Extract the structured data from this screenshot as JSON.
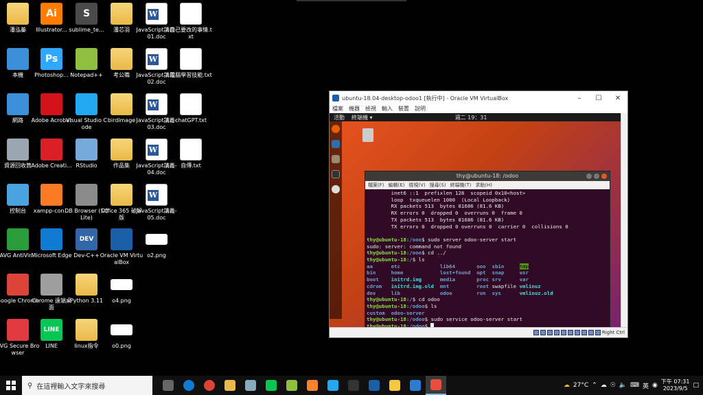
{
  "desktop_icons": [
    {
      "label": "潘泓蓁",
      "icon": "user-folder-icon",
      "color": "#e3b341"
    },
    {
      "label": "本機",
      "icon": "computer-icon",
      "color": "#3b8fd8"
    },
    {
      "label": "網路",
      "icon": "network-icon",
      "color": "#3b8fd8"
    },
    {
      "label": "資源回收筒",
      "icon": "recycle-bin-icon",
      "color": "#9aa6b2"
    },
    {
      "label": "控制台",
      "icon": "control-panel-icon",
      "color": "#4aa3df"
    },
    {
      "label": "AVG AntiVir...",
      "icon": "avg-icon",
      "color": "#2a9d3a"
    },
    {
      "label": "Google Chrome",
      "icon": "chrome-icon",
      "color": "#db4437"
    },
    {
      "label": "AVG Secure Browser",
      "icon": "avg-browser-icon",
      "color": "#e03a3e"
    },
    {
      "label": "Illustrator...",
      "icon": "illustrator-icon",
      "color": "#ff7c00",
      "text": "Ai"
    },
    {
      "label": "Photoshop...",
      "icon": "photoshop-icon",
      "color": "#31a8ff",
      "text": "Ps"
    },
    {
      "label": "Adobe Acrobat",
      "icon": "acrobat-icon",
      "color": "#d4121b"
    },
    {
      "label": "Adobe Creati...",
      "icon": "creative-cloud-icon",
      "color": "#da1f26"
    },
    {
      "label": "xampp-con...",
      "icon": "xampp-icon",
      "color": "#fb7a24"
    },
    {
      "label": "Microsoft Edge",
      "icon": "edge-icon",
      "color": "#0f7bd3"
    },
    {
      "label": "Chrome 遠端桌面",
      "icon": "chrome-remote-icon",
      "color": "#9e9e9e"
    },
    {
      "label": "LINE",
      "icon": "line-icon",
      "color": "#06c755",
      "text": "LINE"
    },
    {
      "label": "sublime_te...",
      "icon": "sublime-icon",
      "color": "#4a4a4a",
      "text": "S"
    },
    {
      "label": "Notepad++",
      "icon": "notepadpp-icon",
      "color": "#90c040"
    },
    {
      "label": "Visual Studio Code",
      "icon": "vscode-icon",
      "color": "#23a9f2"
    },
    {
      "label": "RStudio",
      "icon": "rstudio-icon",
      "color": "#75aadb"
    },
    {
      "label": "DB Browser (SQLite)",
      "icon": "database-icon",
      "color": "#8a8a8a"
    },
    {
      "label": "Dev-C++",
      "icon": "devcpp-icon",
      "color": "#3166a8",
      "text": "DEV"
    },
    {
      "label": "Python 3.11",
      "icon": "python-folder-icon",
      "color": "#e9b949"
    },
    {
      "label": "linux指令",
      "icon": "folder-icon",
      "color": "#e9b949"
    },
    {
      "label": "潘芯羽",
      "icon": "folder-icon",
      "color": "#e9b949"
    },
    {
      "label": "考公職",
      "icon": "folder-icon",
      "color": "#e9b949"
    },
    {
      "label": "birdimage",
      "icon": "folder-icon",
      "color": "#e9b949"
    },
    {
      "label": "作品集",
      "icon": "folder-icon",
      "color": "#e9b949"
    },
    {
      "label": "Office 365 破解版",
      "icon": "folder-icon",
      "color": "#e9b949"
    },
    {
      "label": "Oracle VM VirtualBox",
      "icon": "virtualbox-icon",
      "color": "#1b5fa8"
    },
    {
      "label": "o4.png",
      "icon": "image-icon",
      "color": "#ffffff"
    },
    {
      "label": "o0.png",
      "icon": "image-icon",
      "color": "#ffffff"
    },
    {
      "label": "JavaScript講義-01.doc",
      "icon": "word-doc-icon",
      "color": "#2b579a"
    },
    {
      "label": "JavaScript講義-02.doc",
      "icon": "word-doc-icon",
      "color": "#2b579a"
    },
    {
      "label": "JavaScript講義-03.doc",
      "icon": "word-doc-icon",
      "color": "#2b579a"
    },
    {
      "label": "JavaScript講義-04.doc",
      "icon": "word-doc-icon",
      "color": "#2b579a"
    },
    {
      "label": "JavaScript講義-05.doc",
      "icon": "word-doc-icon",
      "color": "#2b579a"
    },
    {
      "label": "o2.png",
      "icon": "image-icon",
      "color": "#ffffff"
    },
    {
      "label": "自己要改的事情.txt",
      "icon": "text-file-icon",
      "color": "#ffffff"
    },
    {
      "label": "電腦學習技能.txt",
      "icon": "text-file-icon",
      "color": "#ffffff"
    },
    {
      "label": "chatGPT.txt",
      "icon": "text-file-icon",
      "color": "#ffffff"
    },
    {
      "label": "自傳.txt",
      "icon": "text-file-icon",
      "color": "#ffffff"
    }
  ],
  "vbox": {
    "title": "ubuntu-18.04-desktop-odoo1 [執行中] - Oracle VM VirtualBox",
    "menu": [
      "檔案",
      "機器",
      "檢視",
      "輸入",
      "裝置",
      "說明"
    ],
    "host_key": "Right Ctrl",
    "guest": {
      "activities": "活動",
      "app_menu": "終端機 ▾",
      "clock": "週二 19：31"
    }
  },
  "terminal": {
    "title": "thy@ubuntu-18: /odoo",
    "menu": [
      "檔案(F)",
      "編輯(E)",
      "檢視(V)",
      "搜尋(S)",
      "終端機(T)",
      "求助(H)"
    ],
    "lines_plain": [
      "        inet6 ::1  prefixlen 128  scopeid 0x10<host>",
      "        loop  txqueuelen 1000  (Local Loopback)",
      "        RX packets 513  bytes 81686 (81.6 KB)",
      "        RX errors 0  dropped 0  overruns 0  frame 0",
      "        TX packets 513  bytes 81686 (81.6 KB)",
      "        TX errors 0  dropped 0 overruns 0  carrier 0  collisions 0"
    ],
    "prompt_user": "thy@ubuntu-18",
    "cmd1_path": ":/ooo",
    "cmd1": "$ sudo server odoo-server start",
    "cmd1_out": "sudo: server: command not found",
    "cmd2_path": ":/ooo",
    "cmd2": "$ cd ../",
    "cmd3_path": ":/",
    "cmd3": "$ ls",
    "ls_rows": [
      [
        "aa",
        "etc",
        "lib64",
        "ooo",
        "sbin",
        "tmp"
      ],
      [
        "bin",
        "home",
        "lost+found",
        "opt",
        "snap",
        "usr"
      ],
      [
        "boot",
        "initrd.img",
        "media",
        "proc",
        "srv",
        "var"
      ],
      [
        "cdrom",
        "initrd.img.old",
        "mnt",
        "root",
        "swapfile",
        "vmlinuz"
      ],
      [
        "dev",
        "lib",
        "odoo",
        "run",
        "sys",
        "vmlinuz.old"
      ]
    ],
    "cmd4_path": ":/",
    "cmd4": "$ cd odoo",
    "cmd5_path": ":/odoo",
    "cmd5": "$ ls",
    "ls2": "custom  odoo-server",
    "cmd6_path": ":/odoo",
    "cmd6": "$ sudo service odoo-server start",
    "cmd7_path": ":/odoo",
    "cmd7": "$ "
  },
  "taskbar": {
    "search_placeholder": "在這裡輸入文字來搜尋",
    "apps": [
      "task-view-icon",
      "edge-icon",
      "chrome-icon",
      "file-explorer-icon",
      "photos-icon",
      "line-icon",
      "notepadpp-icon",
      "sublime-icon",
      "vscode-icon",
      "terminal-icon",
      "virtualbox-icon",
      "python-icon",
      "photo-viewer-icon",
      "snipping-icon"
    ],
    "weather": "27°C",
    "ime": "英",
    "time": "下午 07:31",
    "date": "2023/9/5"
  }
}
